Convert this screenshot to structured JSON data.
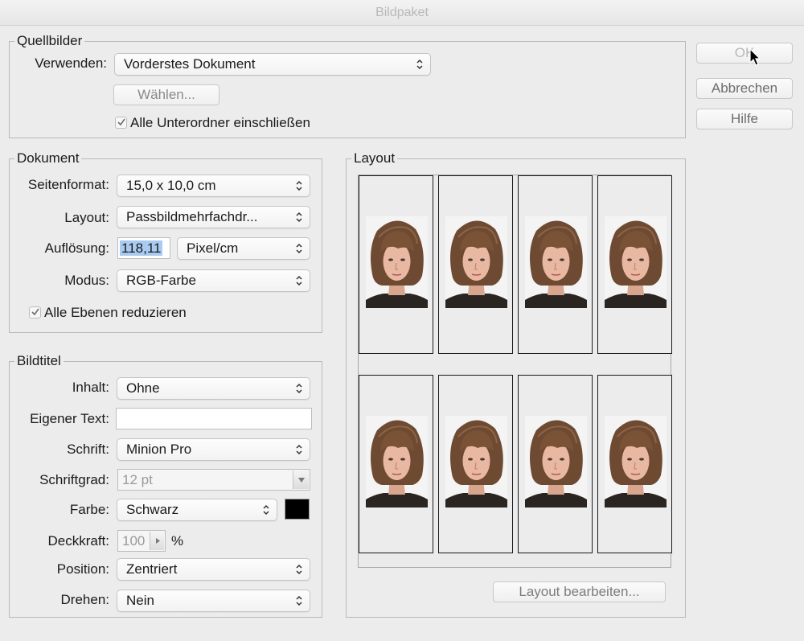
{
  "window": {
    "title": "Bildpaket"
  },
  "buttons": {
    "ok": "OK",
    "cancel": "Abbrechen",
    "help": "Hilfe"
  },
  "source": {
    "legend": "Quellbilder",
    "use_label": "Verwenden:",
    "use_value": "Vorderstes Dokument",
    "choose_button": "Wählen...",
    "include_subfolders": "Alle Unterordner einschließen",
    "include_subfolders_checked": true
  },
  "document": {
    "legend": "Dokument",
    "page_size_label": "Seitenformat:",
    "page_size_value": "15,0 x 10,0 cm",
    "layout_label": "Layout:",
    "layout_value": "Passbildmehrfachdr...",
    "resolution_label": "Auflösung:",
    "resolution_value": "118,11",
    "resolution_unit": "Pixel/cm",
    "mode_label": "Modus:",
    "mode_value": "RGB-Farbe",
    "flatten_layers": "Alle Ebenen reduzieren",
    "flatten_layers_checked": true
  },
  "label_section": {
    "legend": "Bildtitel",
    "content_label": "Inhalt:",
    "content_value": "Ohne",
    "custom_text_label": "Eigener Text:",
    "custom_text_value": "",
    "font_label": "Schrift:",
    "font_value": "Minion Pro",
    "font_size_label": "Schriftgrad:",
    "font_size_value": "12 pt",
    "color_label": "Farbe:",
    "color_value": "Schwarz",
    "color_swatch": "#000000",
    "opacity_label": "Deckkraft:",
    "opacity_value": "100",
    "opacity_unit": "%",
    "position_label": "Position:",
    "position_value": "Zentriert",
    "rotate_label": "Drehen:",
    "rotate_value": "Nein"
  },
  "layout": {
    "legend": "Layout",
    "edit_button": "Layout bearbeiten...",
    "photo_count": 8
  },
  "icons": {
    "select_arrows": "updown-chevron-icon",
    "checkmark": "checkmark-icon",
    "stepper": "triangle-right-icon",
    "combo": "triangle-down-icon",
    "cursor": "mouse-pointer-icon"
  }
}
